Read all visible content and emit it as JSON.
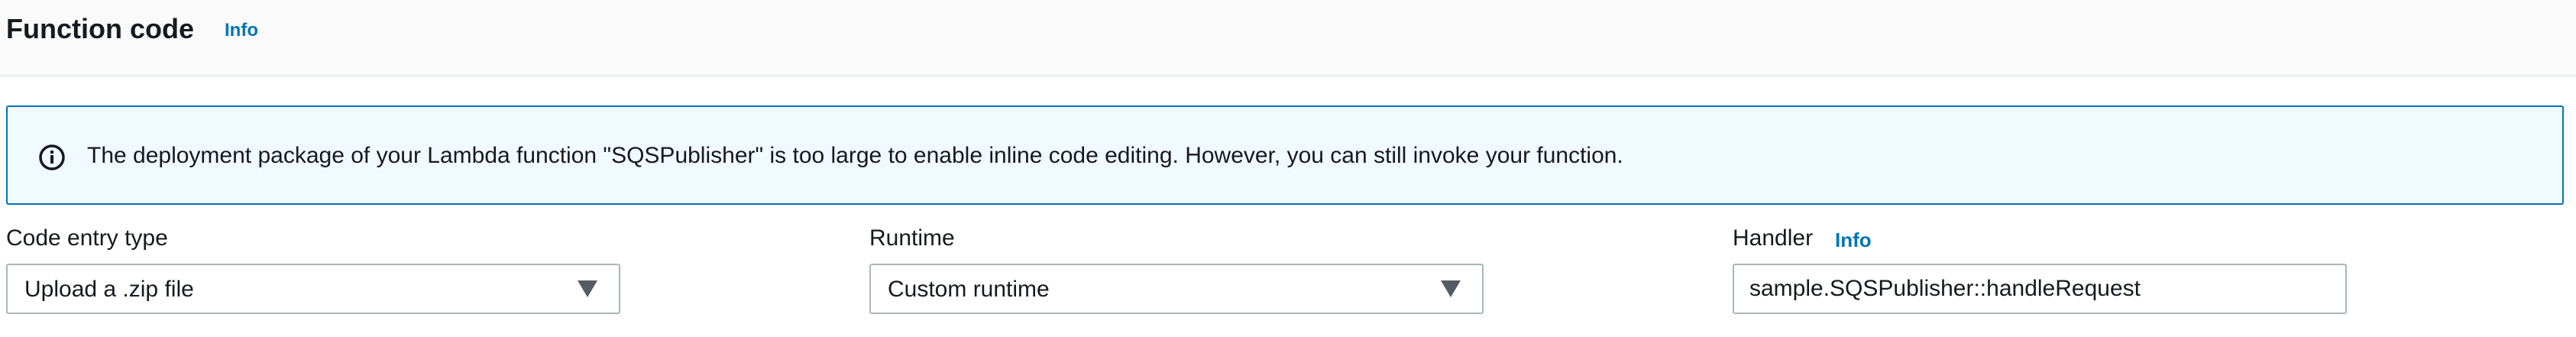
{
  "section": {
    "title": "Function code",
    "info_label": "Info"
  },
  "alert": {
    "icon": "info-circle-icon",
    "message": "The deployment package of your Lambda function \"SQSPublisher\" is too large to enable inline code editing. However, you can still invoke your function."
  },
  "fields": {
    "code_entry_type": {
      "label": "Code entry type",
      "selected_value": "Upload a .zip file"
    },
    "runtime": {
      "label": "Runtime",
      "selected_value": "Custom runtime"
    },
    "handler": {
      "label": "Handler",
      "info_label": "Info",
      "value": "sample.SQSPublisher::handleRequest"
    }
  },
  "colors": {
    "link": "#0073bb",
    "alert_border": "#0073bb",
    "alert_background": "#f1faff",
    "input_border": "#aab7b8",
    "text": "#16191f",
    "header_background": "#fafafa"
  }
}
